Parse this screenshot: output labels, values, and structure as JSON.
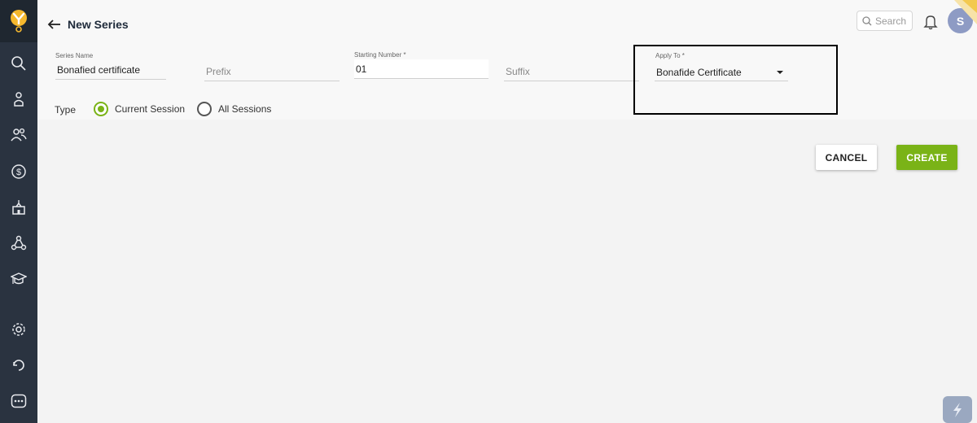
{
  "header": {
    "title": "New Series",
    "search_placeholder": "Search",
    "avatar_initial": "S"
  },
  "form": {
    "series_name": {
      "label": "Series Name",
      "value": "Bonafied certificate"
    },
    "prefix": {
      "placeholder": "Prefix"
    },
    "starting_number": {
      "label": "Starting Number *",
      "value": "01"
    },
    "suffix": {
      "placeholder": "Suffix"
    },
    "apply_to": {
      "label": "Apply To *",
      "value": "Bonafide Certificate"
    },
    "type": {
      "label": "Type",
      "options": [
        "Current Session",
        "All Sessions"
      ],
      "selected": "Current Session"
    }
  },
  "actions": {
    "cancel_label": "CANCEL",
    "create_label": "CREATE"
  },
  "colors": {
    "sidebar": "#2a3340",
    "accent": "#7ab317",
    "avatar": "#8e9bc4"
  }
}
